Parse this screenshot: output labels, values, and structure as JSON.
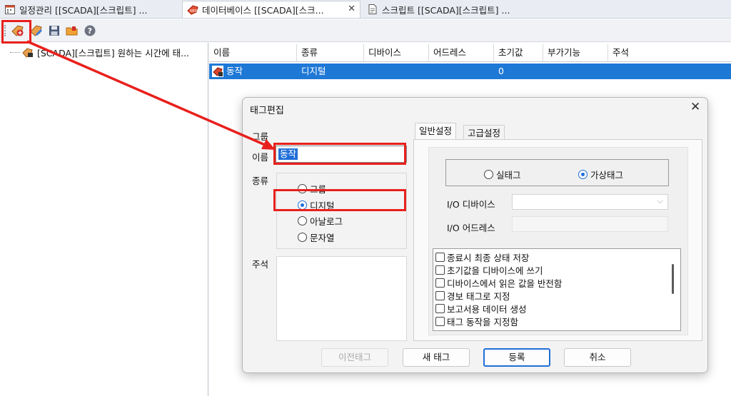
{
  "tabs": [
    {
      "label": "일정관리 [[SCADA][스크립트] ...",
      "icon": "calendar-icon"
    },
    {
      "label": "데이터베이스 [[SCADA][스크...",
      "icon": "new-tag-icon",
      "close": "✕"
    },
    {
      "label": "스크립트 [[SCADA][스크립트] ...",
      "icon": "script-icon"
    }
  ],
  "toolbar": {
    "icons": [
      "add-tag-icon",
      "edit-tag-icon",
      "save-icon",
      "open-folder-icon",
      "help-icon"
    ]
  },
  "tree": {
    "item_label": "[SCADA][스크립트] 원하는 시간에 태..."
  },
  "grid": {
    "columns": [
      "이름",
      "종류",
      "디바이스",
      "어드레스",
      "초기값",
      "부가기능",
      "주석"
    ],
    "row": {
      "name": "동작",
      "type": "디지털",
      "device": "",
      "address": "",
      "initial": "0",
      "extra": "",
      "note": ""
    }
  },
  "dialog": {
    "title": "태그편집",
    "close": "✕",
    "group_label": "그룹",
    "name_label": "이름",
    "name_value": "동작",
    "type_label": "종류",
    "type_options": [
      "그룹",
      "디지털",
      "아날로그",
      "문자열"
    ],
    "type_selected": "디지털",
    "note_label": "주석",
    "tabs": [
      "일반설정",
      "고급설정"
    ],
    "tag_kind": {
      "real": "실태그",
      "virtual": "가상태그",
      "selected": "가상태그"
    },
    "io_device_label": "I/O 디바이스",
    "io_address_label": "I/O 어드레스",
    "options": [
      "종료시 최종 상태 저장",
      "초기값을 디바이스에 쓰기",
      "디바이스에서 읽은 값을 반전함",
      "경보 태그로 지정",
      "보고서용 데이터 생성",
      "태그 동작을 지정함"
    ],
    "buttons": {
      "prev": "이전태그",
      "new": "새 태그",
      "ok": "등록",
      "cancel": "취소"
    }
  },
  "colors": {
    "selection": "#1e78d6",
    "highlight": "#e8201c",
    "accent": "#1f6fd8"
  }
}
